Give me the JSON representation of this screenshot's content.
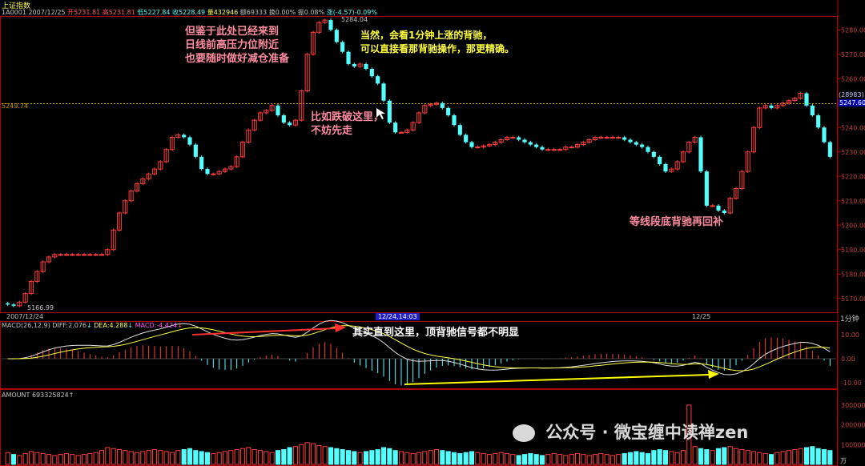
{
  "window": {
    "title": "上证指数",
    "code": "1A0001",
    "date": "2007/12/25"
  },
  "header": {
    "open_label": "开",
    "open": "5231.81",
    "high_label": "高",
    "high": "5231.81",
    "low_label": "低",
    "low": "5227.84",
    "close_label": "收",
    "close": "5228.49",
    "volume_label": "量",
    "volume": "432946",
    "amount_label": "额",
    "amount": "69333",
    "turnover_label": "换",
    "turnover": "0.00%",
    "amplitude_label": "振",
    "amplitude": "0.08%",
    "change_label": "涨",
    "change": "(-4.57)-0.09%"
  },
  "price_axis": {
    "ticks": [
      "5280.00",
      "5270.00",
      "5260.00",
      "5250.00",
      "5240.00",
      "5230.00",
      "5220.00",
      "5210.00",
      "5200.00",
      "5190.00",
      "5180.00",
      "5170.00"
    ],
    "ref_left": "5249.74",
    "ref_right": "5247.60",
    "tag_right": "(28983)"
  },
  "time_axis": {
    "start": "2007/12/24",
    "cursor": "12/24,14:03",
    "day2": "12/25",
    "period": "1分钟"
  },
  "macd": {
    "header": "MACD(26,12,9)",
    "diff_label": "DIFF:",
    "diff": "2.076",
    "dea_label": "DEA:",
    "dea": "4.288",
    "macd_label": "MACD:",
    "macd": "-4.424",
    "ticks": [
      "10.00",
      "0.00",
      "-10.00"
    ]
  },
  "amount_panel": {
    "header": "AMOUNT",
    "value": "693325824",
    "ticks": [
      "300000",
      "200000",
      "100000"
    ],
    "unit": "万"
  },
  "annotations": {
    "note1_line1": "但鉴于此处已经来到",
    "note1_line2": "日线前高压力位附近",
    "note1_line3": "也要随时做好减仓准备",
    "note2_line1": "当然，会看1分钟上涨的背驰，",
    "note2_line2": "可以直接看那背驰操作，那更精确。",
    "note3_line1": "比如跌破这里，",
    "note3_line2": "不妨先走",
    "note4": "等线段底背驰再回补",
    "note5": "其实直到这里，顶背驰信号都不明显",
    "low_label": "5166.99",
    "high_label": "5284.04"
  },
  "watermark": "公众号 · 微宝缠中读禅zen",
  "chart_data": {
    "type": "candlestick",
    "title": "上证指数",
    "x_start": "2007/12/24",
    "x_cursor": "12/24,14:03",
    "x_day2": "12/25",
    "ylim": [
      5165,
      5285
    ],
    "ref_price": 5249.74,
    "annotated_high": 5284.04,
    "annotated_low": 5166.99,
    "close": [
      5167.5,
      5167.0,
      5168.5,
      5172,
      5177,
      5181,
      5185,
      5187,
      5188,
      5188,
      5188,
      5188,
      5188,
      5188,
      5188,
      5188,
      5188,
      5190,
      5198,
      5205,
      5210,
      5214,
      5217,
      5219,
      5221,
      5223,
      5226,
      5231,
      5236,
      5237,
      5236,
      5233,
      5228,
      5223,
      5221,
      5221,
      5222,
      5223,
      5224,
      5228,
      5234,
      5239,
      5243,
      5246,
      5247,
      5249,
      5245,
      5242,
      5241,
      5243,
      5255,
      5270,
      5279,
      5283,
      5284,
      5280,
      5275,
      5271,
      5266,
      5265,
      5266,
      5264,
      5261,
      5258,
      5251,
      5242,
      5238,
      5238,
      5239,
      5242,
      5246,
      5249,
      5249.5,
      5250,
      5248,
      5245,
      5241,
      5237,
      5234,
      5232,
      5232,
      5232.5,
      5233,
      5234,
      5235,
      5236,
      5236,
      5235,
      5234,
      5233,
      5232,
      5231,
      5231,
      5231,
      5231,
      5232,
      5232,
      5233,
      5234,
      5235,
      5236,
      5236,
      5236,
      5236,
      5236,
      5235,
      5234,
      5233,
      5232,
      5230,
      5228,
      5225,
      5222,
      5223,
      5226,
      5230,
      5234,
      5236,
      5222,
      5208,
      5208,
      5206,
      5205,
      5211,
      5215,
      5222,
      5230,
      5240,
      5248,
      5249,
      5248,
      5249,
      5250,
      5251,
      5252,
      5254,
      5249,
      5245,
      5240,
      5234,
      5228
    ],
    "volume": [
      60,
      50,
      45,
      55,
      65,
      60,
      55,
      50,
      45,
      50,
      55,
      50,
      45,
      50,
      55,
      60,
      70,
      85,
      80,
      75,
      70,
      65,
      60,
      65,
      70,
      75,
      70,
      65,
      60,
      70,
      75,
      80,
      70,
      65,
      60,
      55,
      60,
      65,
      70,
      75,
      80,
      85,
      75,
      70,
      65,
      60,
      70,
      75,
      85,
      90,
      100,
      110,
      105,
      95,
      90,
      85,
      80,
      75,
      70,
      65,
      60,
      65,
      70,
      75,
      85,
      80,
      70,
      65,
      60,
      55,
      60,
      65,
      70,
      75,
      70,
      65,
      60,
      55,
      60,
      65,
      60,
      55,
      50,
      55,
      60,
      55,
      50,
      45,
      50,
      55,
      50,
      45,
      50,
      55,
      50,
      45,
      50,
      55,
      50,
      45,
      50,
      55,
      50,
      45,
      50,
      55,
      60,
      65,
      60,
      55,
      70,
      75,
      70,
      65,
      60,
      70,
      300,
      90,
      80,
      75,
      70,
      80,
      85,
      90,
      80,
      75,
      70,
      65,
      60,
      55,
      50,
      60,
      65,
      70,
      75,
      80,
      85,
      90,
      80,
      75,
      70
    ],
    "macd_ylim": [
      -12,
      12
    ]
  }
}
